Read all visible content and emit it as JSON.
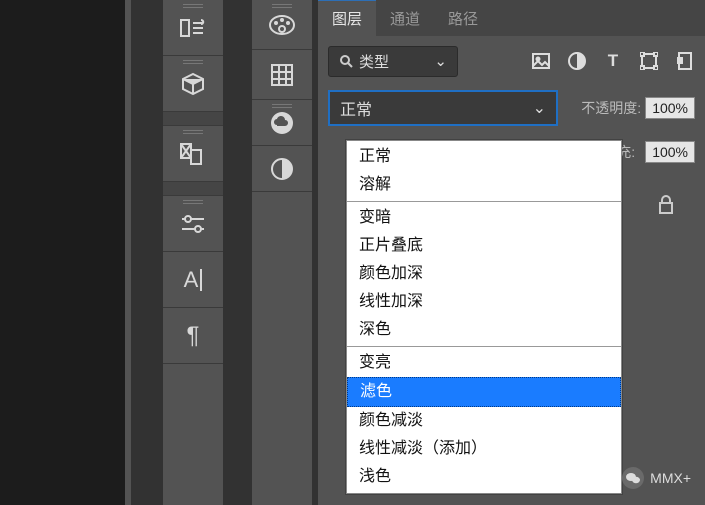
{
  "tabs": {
    "layers": "图层",
    "channels": "通道",
    "paths": "路径"
  },
  "filter": {
    "label": "类型"
  },
  "blend": {
    "selected": "正常"
  },
  "opacity": {
    "label": "不透明度:",
    "value": "100%"
  },
  "fill": {
    "label": "填充:",
    "value": "100%"
  },
  "dropdown_groups": [
    [
      "正常",
      "溶解"
    ],
    [
      "变暗",
      "正片叠底",
      "颜色加深",
      "线性加深",
      "深色"
    ],
    [
      "变亮",
      "滤色",
      "颜色减淡",
      "线性减淡（添加）",
      "浅色"
    ]
  ],
  "dropdown_selected": "滤色",
  "watermark": "MMX+"
}
